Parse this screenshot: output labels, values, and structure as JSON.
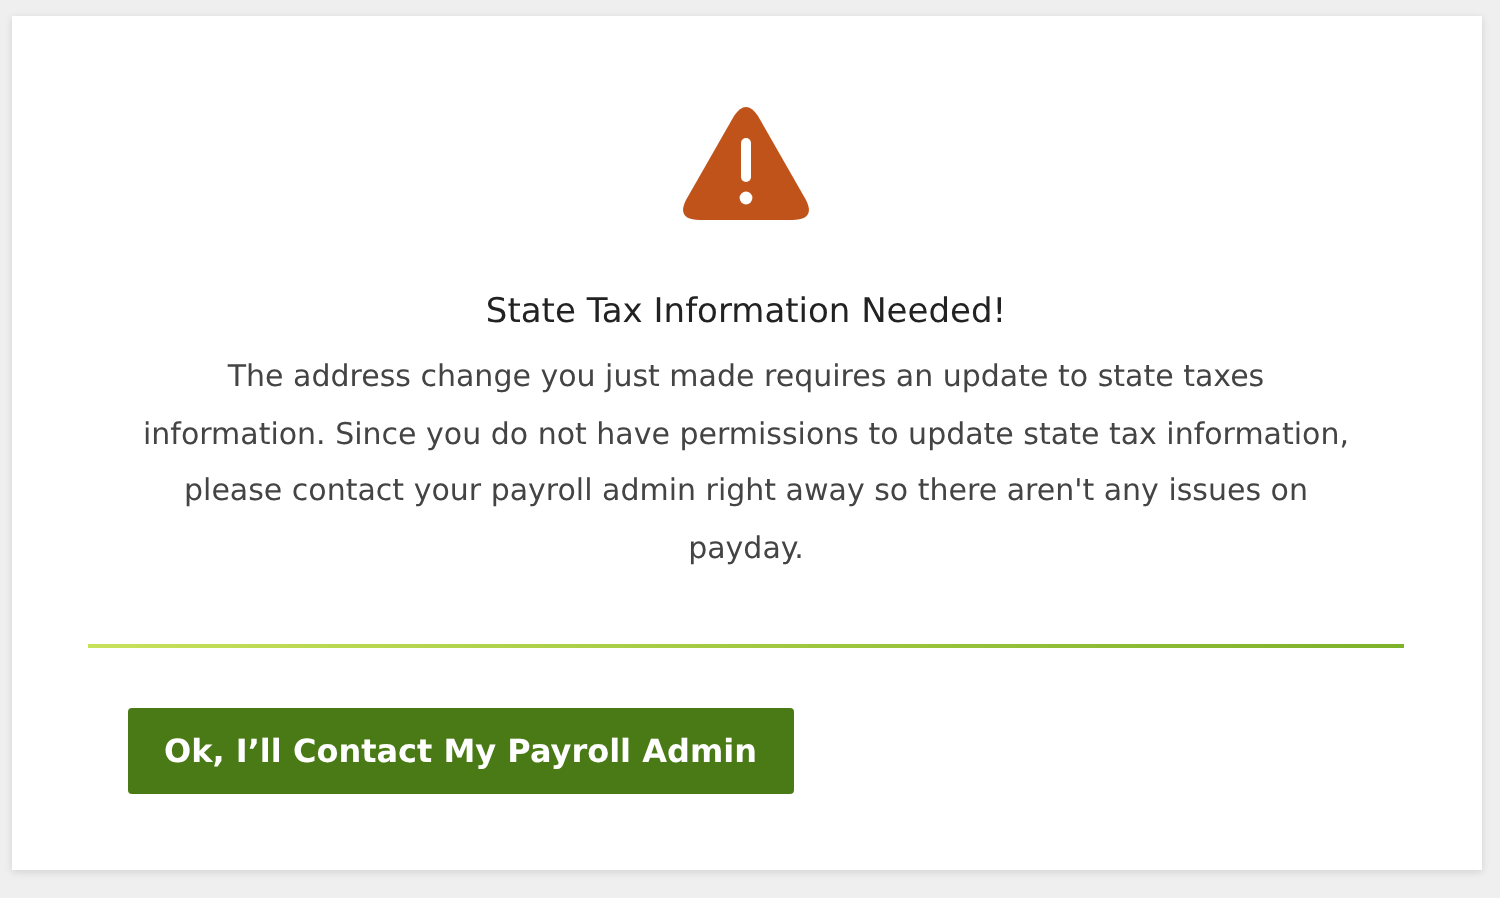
{
  "dialog": {
    "title": "State Tax Information Needed!",
    "message": "The address change you just made requires an update to state taxes information. Since you do not have permissions to update state tax information, please contact your payroll admin right away so there aren't any issues on payday.",
    "button": "Ok, I’ll Contact My Payroll Admin"
  }
}
